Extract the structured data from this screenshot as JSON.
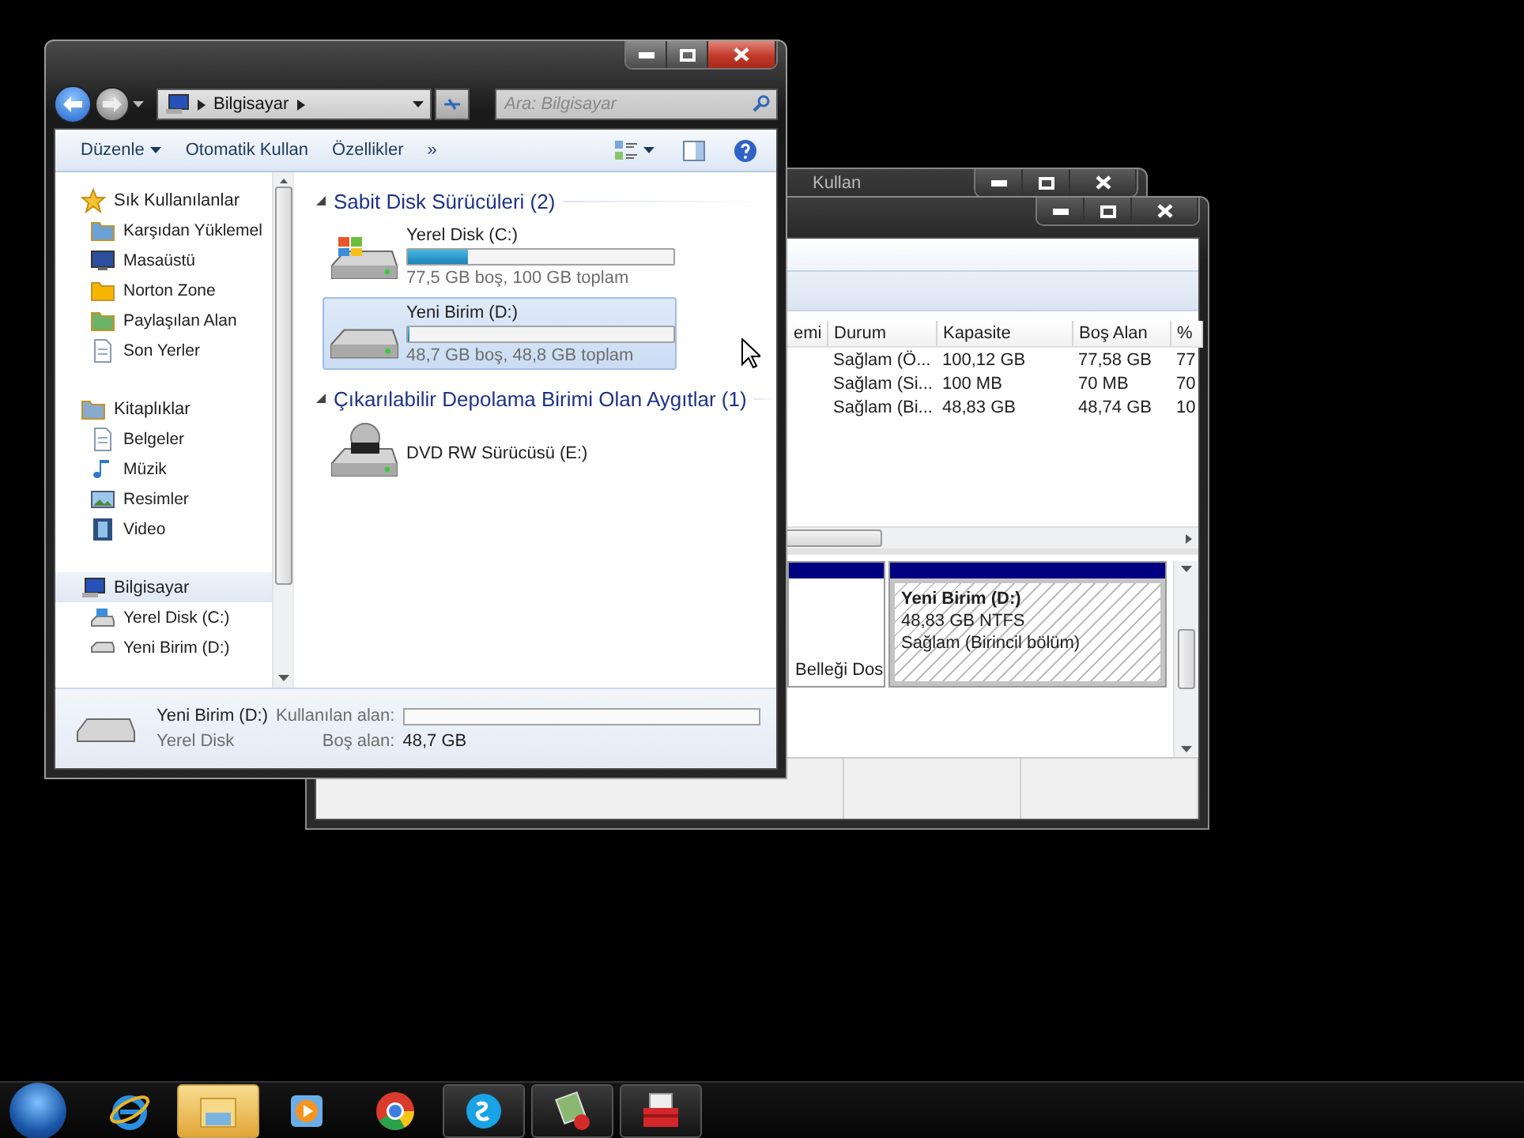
{
  "explorer": {
    "address": {
      "crumbs": [
        "Bilgisayar"
      ]
    },
    "search": {
      "placeholder": "Ara: Bilgisayar"
    },
    "toolbar": [
      {
        "label": "Düzenle",
        "kind": "menu"
      },
      {
        "label": "Otomatik Kullan",
        "kind": "plain"
      },
      {
        "label": "Özellikler",
        "kind": "plain"
      },
      {
        "label": "»",
        "kind": "plain"
      }
    ],
    "sidebar": {
      "groups": [
        {
          "label": "Sık Kullanılanlar",
          "selected": false,
          "children": [
            {
              "label": "Karşıdan Yüklemel",
              "selected": false
            },
            {
              "label": "Masaüstü",
              "selected": false
            },
            {
              "label": "Norton Zone",
              "selected": false
            },
            {
              "label": "Paylaşılan Alan",
              "selected": false
            },
            {
              "label": "Son Yerler",
              "selected": false
            }
          ]
        },
        {
          "label": "Kitaplıklar",
          "selected": false,
          "children": [
            {
              "label": "Belgeler",
              "selected": false
            },
            {
              "label": "Müzik",
              "selected": false
            },
            {
              "label": "Resimler",
              "selected": false
            },
            {
              "label": "Video",
              "selected": false
            }
          ]
        },
        {
          "label": "Bilgisayar",
          "selected": true,
          "children": [
            {
              "label": "Yerel Disk (C:)",
              "selected": false
            },
            {
              "label": "Yeni Birim (D:)",
              "selected": false
            }
          ]
        }
      ]
    },
    "content": {
      "groups": [
        {
          "title": "Sabit Disk Sürücüleri (2)",
          "items": [
            {
              "kind": "disk",
              "name": "Yerel Disk (C:)",
              "level": 0.225,
              "caption": "77,5 GB boş, 100 GB toplam",
              "selected": false
            },
            {
              "kind": "disk",
              "name": "Yeni Birim (D:)",
              "level": 0.003,
              "caption": "48,7 GB boş, 48,8 GB toplam",
              "selected": true
            }
          ]
        },
        {
          "title": "Çıkarılabilir Depolama Birimi Olan Aygıtlar (1)",
          "items": [
            {
              "kind": "optical",
              "name": "DVD RW Sürücüsü (E:)",
              "selected": false
            }
          ]
        }
      ]
    },
    "details": {
      "name": "Yeni Birim (D:)",
      "type": "Yerel Disk",
      "used": {
        "label": "Kullanılan alan:",
        "level": 0.003
      },
      "free": {
        "label": "Boş alan:",
        "value": "48,7 GB"
      }
    }
  },
  "back_window": {
    "title": "Kullan"
  },
  "disk_manager": {
    "table": {
      "columns": [
        "emi",
        "Durum",
        "Kapasite",
        "Boş Alan",
        "%"
      ],
      "rows": [
        [
          "",
          "Sağlam (Ö...",
          "100,12 GB",
          "77,58 GB",
          "77"
        ],
        [
          "",
          "Sağlam (Si...",
          "100 MB",
          "70 MB",
          "70"
        ],
        [
          "",
          "Sağlam (Bi...",
          "48,83 GB",
          "48,74 GB",
          "10"
        ]
      ]
    },
    "partitions": [
      {
        "status": "Belleği Dos",
        "selected": false
      },
      {
        "name": "Yeni Birim  (D:)",
        "size": "48,83 GB NTFS",
        "status": "Sağlam (Birincil bölüm)",
        "selected": true
      }
    ]
  },
  "taskbar": {
    "items": [
      {
        "running": false,
        "selected": false
      },
      {
        "running": true,
        "selected": true
      },
      {
        "running": false,
        "selected": false
      },
      {
        "running": false,
        "selected": false
      },
      {
        "running": true,
        "selected": false
      },
      {
        "running": true,
        "selected": false
      },
      {
        "running": true,
        "selected": false
      }
    ]
  }
}
